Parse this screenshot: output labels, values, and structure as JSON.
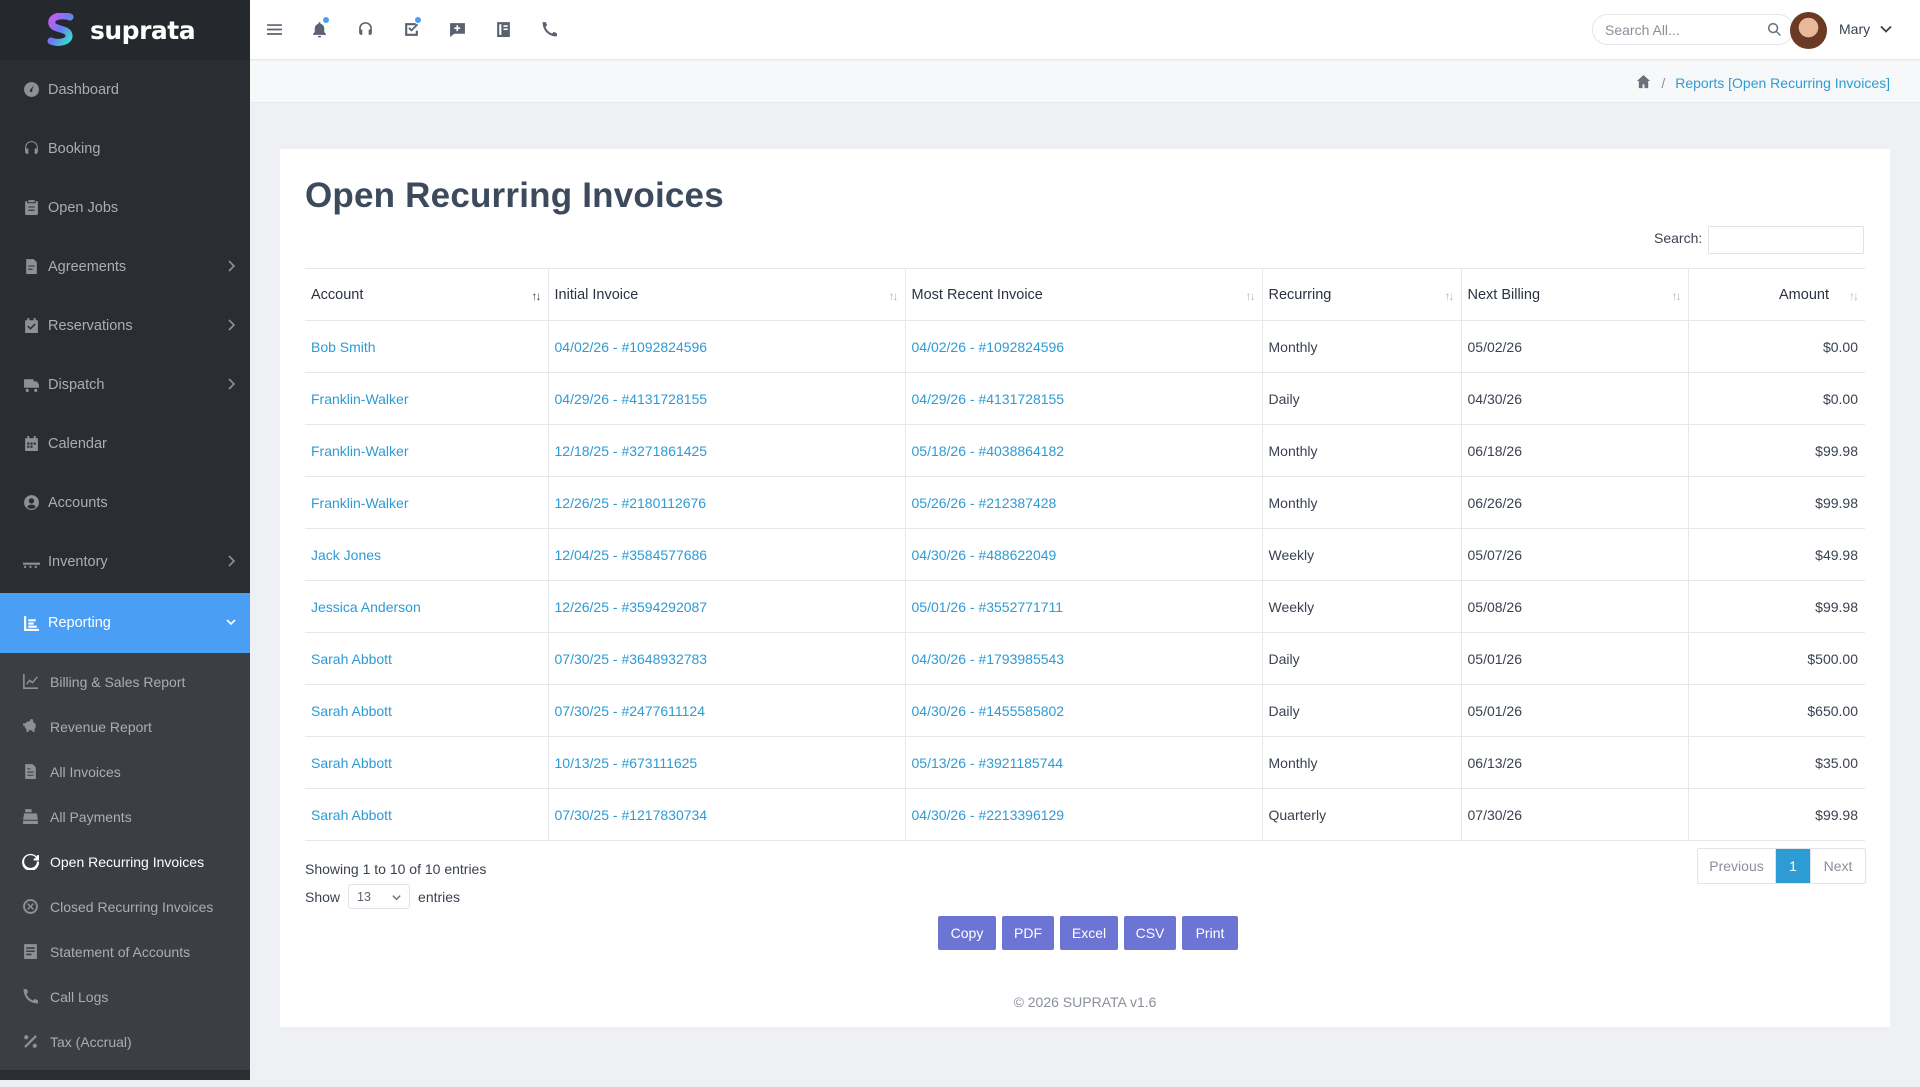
{
  "brand": {
    "name": "suprata"
  },
  "sidebar": {
    "items": [
      {
        "label": "Dashboard",
        "icon": "dashboard-icon"
      },
      {
        "label": "Booking",
        "icon": "headset-icon"
      },
      {
        "label": "Open Jobs",
        "icon": "clipboard-icon"
      },
      {
        "label": "Agreements",
        "icon": "file-signature-icon",
        "has_children": true
      },
      {
        "label": "Reservations",
        "icon": "calendar-check-icon",
        "has_children": true
      },
      {
        "label": "Dispatch",
        "icon": "truck-icon",
        "has_children": true
      },
      {
        "label": "Calendar",
        "icon": "calendar-icon"
      },
      {
        "label": "Accounts",
        "icon": "user-circle-icon"
      },
      {
        "label": "Inventory",
        "icon": "dolly-icon",
        "has_children": true
      },
      {
        "label": "Reporting",
        "icon": "chart-bar-icon",
        "has_children": true,
        "active": true
      }
    ],
    "sub_items": [
      {
        "label": "Billing & Sales Report",
        "icon": "chart-line-icon"
      },
      {
        "label": "Revenue Report",
        "icon": "piggy-bank-icon"
      },
      {
        "label": "All Invoices",
        "icon": "invoice-icon"
      },
      {
        "label": "All Payments",
        "icon": "cash-register-icon"
      },
      {
        "label": "Open Recurring Invoices",
        "icon": "refresh-icon",
        "active": true
      },
      {
        "label": "Closed Recurring Invoices",
        "icon": "times-circle-icon"
      },
      {
        "label": "Statement of Accounts",
        "icon": "statement-icon"
      },
      {
        "label": "Call Logs",
        "icon": "phone-icon"
      },
      {
        "label": "Tax (Accrual)",
        "icon": "percent-icon"
      }
    ]
  },
  "topbar": {
    "search_placeholder": "Search All...",
    "user_name": "Mary"
  },
  "breadcrumb": {
    "current": "Reports [Open Recurring Invoices]"
  },
  "page": {
    "title": "Open Recurring Invoices",
    "search_label": "Search:",
    "columns": [
      "Account",
      "Initial Invoice",
      "Most Recent Invoice",
      "Recurring",
      "Next Billing",
      "Amount"
    ],
    "rows": [
      {
        "account": "Bob Smith",
        "initial": "04/02/26 - #1092824596",
        "recent": "04/02/26 - #1092824596",
        "recurring": "Monthly",
        "next": "05/02/26",
        "amount": "$0.00"
      },
      {
        "account": "Franklin-Walker",
        "initial": "04/29/26 - #4131728155",
        "recent": "04/29/26 - #4131728155",
        "recurring": "Daily",
        "next": "04/30/26",
        "amount": "$0.00"
      },
      {
        "account": "Franklin-Walker",
        "initial": "12/18/25 - #3271861425",
        "recent": "05/18/26 - #4038864182",
        "recurring": "Monthly",
        "next": "06/18/26",
        "amount": "$99.98"
      },
      {
        "account": "Franklin-Walker",
        "initial": "12/26/25 - #2180112676",
        "recent": "05/26/26 - #212387428",
        "recurring": "Monthly",
        "next": "06/26/26",
        "amount": "$99.98"
      },
      {
        "account": "Jack Jones",
        "initial": "12/04/25 - #3584577686",
        "recent": "04/30/26 - #488622049",
        "recurring": "Weekly",
        "next": "05/07/26",
        "amount": "$49.98"
      },
      {
        "account": "Jessica Anderson",
        "initial": "12/26/25 - #3594292087",
        "recent": "05/01/26 - #3552771711",
        "recurring": "Weekly",
        "next": "05/08/26",
        "amount": "$99.98"
      },
      {
        "account": "Sarah Abbott",
        "initial": "07/30/25 - #3648932783",
        "recent": "04/30/26 - #1793985543",
        "recurring": "Daily",
        "next": "05/01/26",
        "amount": "$500.00"
      },
      {
        "account": "Sarah Abbott",
        "initial": "07/30/25 - #2477611124",
        "recent": "04/30/26 - #1455585802",
        "recurring": "Daily",
        "next": "05/01/26",
        "amount": "$650.00"
      },
      {
        "account": "Sarah Abbott",
        "initial": "10/13/25 - #673111625",
        "recent": "05/13/26 - #3921185744",
        "recurring": "Monthly",
        "next": "06/13/26",
        "amount": "$35.00"
      },
      {
        "account": "Sarah Abbott",
        "initial": "07/30/25 - #1217830734",
        "recent": "04/30/26 - #2213396129",
        "recurring": "Quarterly",
        "next": "07/30/26",
        "amount": "$99.98"
      }
    ],
    "info": "Showing 1 to 10 of 10 entries",
    "show_prefix": "Show",
    "show_value": "13",
    "show_suffix": "entries",
    "pager": {
      "prev": "Previous",
      "current": "1",
      "next": "Next"
    },
    "export_buttons": [
      "Copy",
      "PDF",
      "Excel",
      "CSV",
      "Print"
    ],
    "footer": "© 2026 SUPRATA v1.6"
  },
  "colors": {
    "sidebar_bg": "#2a2d32",
    "active_nav": "#4a9ff5",
    "link": "#2d9bd4",
    "export_button": "#6c74d4"
  }
}
